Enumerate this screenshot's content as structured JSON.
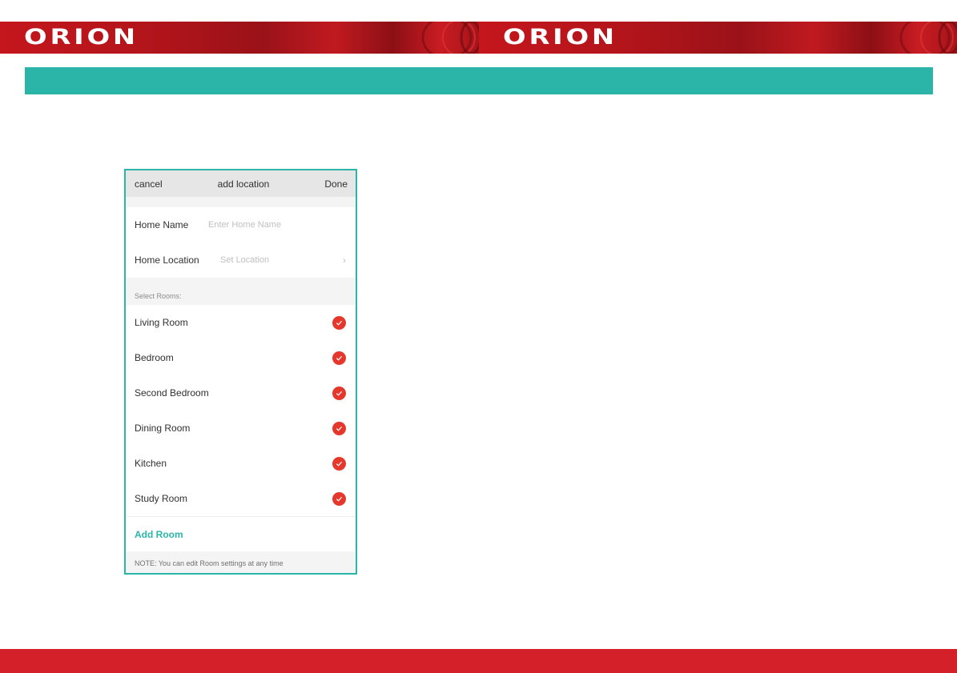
{
  "brand": {
    "logo_left": "ORION",
    "logo_right": "ORION",
    "banner_color": "#c4161c",
    "accent_teal": "#2bb5a8",
    "footer_color": "#d32029"
  },
  "screen": {
    "nav": {
      "cancel_label": "cancel",
      "title": "add location",
      "done_label": "Done"
    },
    "home_name": {
      "label": "Home Name",
      "placeholder": "Enter Home Name"
    },
    "home_location": {
      "label": "Home Location",
      "placeholder": "Set Location",
      "icon": "chevron-right-icon"
    },
    "rooms_section_label": "Select Rooms:",
    "rooms": [
      {
        "label": "Living Room",
        "checked": true
      },
      {
        "label": "Bedroom",
        "checked": true
      },
      {
        "label": "Second Bedroom",
        "checked": true
      },
      {
        "label": "Dining Room",
        "checked": true
      },
      {
        "label": "Kitchen",
        "checked": true
      },
      {
        "label": "Study Room",
        "checked": true
      }
    ],
    "check_color": "#e5372c",
    "add_room_label": "Add Room",
    "note": "NOTE: You can edit Room settings at any time"
  }
}
